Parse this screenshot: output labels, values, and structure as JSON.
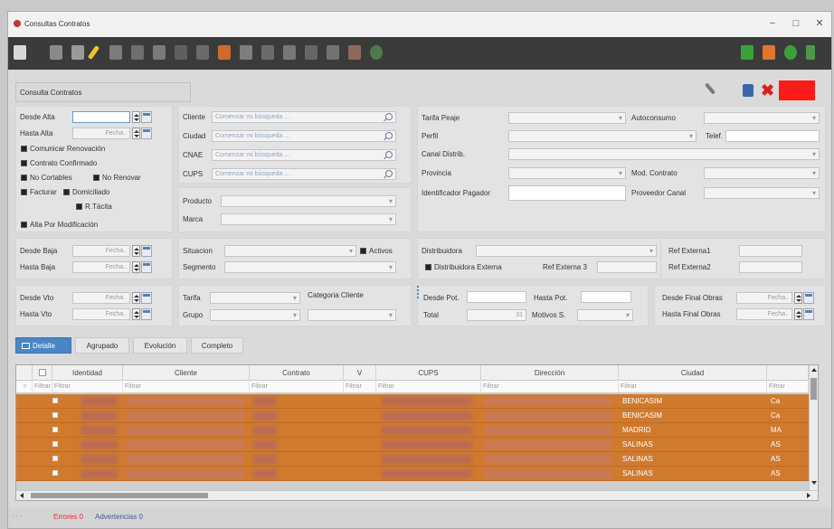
{
  "window": {
    "title": "Consultas Contratos",
    "minimize": "−",
    "maximize": "□",
    "close": "✕"
  },
  "header": {
    "title": "Consulta Contratos",
    "cancel_label": "Cancel"
  },
  "filters": {
    "desde_alta": "Desde Alta",
    "hasta_alta": "Hasta Alta",
    "fecha_placeholder": "Fecha..",
    "comunicar_renovacion": "Comunicar Renovación",
    "contrato_confirmado": "Contrato Confirmado",
    "no_cortables": "No Cortables",
    "no_renovar": "No Renovar",
    "facturar": "Facturar",
    "domiciliado": "Domiciliado",
    "r_tacita": "R.Tácita",
    "alta_por_modificacion": "Alta Por Modificación",
    "cliente": "Cliente",
    "ciudad": "Ciudad",
    "cnae": "CNAE",
    "cups": "CUPS",
    "search_placeholder": "Comenzar mi búsqueda ...",
    "producto": "Producto",
    "marca": "Marca",
    "tarifa_peaje": "Tarifa Peaje",
    "autoconsumo": "Autoconsumo",
    "perfil": "Perfil",
    "telef": "Telef.",
    "canal_distrib": "Canal Distrib.",
    "provincia": "Provincia",
    "mod_contrato": "Mod. Contrato",
    "identificador_pagador": "Identificador Pagador",
    "proveedor_canal": "Proveedor Canal",
    "desde_baja": "Desde Baja",
    "hasta_baja": "Hasta Baja",
    "situacion": "Situacion",
    "activos": "Activos",
    "segmento": "Segmento",
    "distribuidora": "Distribuidora",
    "distribuidora_externa": "Distribuidora Externa",
    "ref_externa1": "Ref Externa1",
    "ref_externa2": "Ref Externa2",
    "ref_externa3": "Ref Externa 3",
    "desde_vto": "Desde Vto",
    "hasta_vto": "Hasta Vto",
    "tarifa": "Tarifa",
    "categoria_cliente": "Categoria Cliente",
    "grupo": "Grupo",
    "desde_pot": "Desde Pot.",
    "hasta_pot": "Hasta Pot.",
    "total": "Total",
    "total_value": "31",
    "motivos_s": "Motivos S.",
    "desde_final_obras": "Desde Final Obras",
    "hasta_final_obras": "Hasta Final Obras"
  },
  "tabs": [
    {
      "label": "Detalle"
    },
    {
      "label": "Agrupado"
    },
    {
      "label": "Evolución"
    },
    {
      "label": "Completo"
    }
  ],
  "grid": {
    "columns": [
      "Identidad",
      "Cliente",
      "Contrato",
      "V",
      "CUPS",
      "Dirección",
      "Ciudad"
    ],
    "filter_placeholder": "Filtrar",
    "rows": [
      {
        "ciudad": "BENICASIM",
        "extra": "Ca"
      },
      {
        "ciudad": "BENICASIM",
        "extra": "Ca"
      },
      {
        "ciudad": "MADRID",
        "extra": "MA"
      },
      {
        "ciudad": "SALINAS",
        "extra": "AS"
      },
      {
        "ciudad": "SALINAS",
        "extra": "AS"
      },
      {
        "ciudad": "SALINAS",
        "extra": "AS"
      }
    ]
  },
  "status": {
    "errores": "Errores 0",
    "advertencias": "Advertencias 0"
  },
  "colors": {
    "accent": "#4a86c5",
    "row": "#d07a2e",
    "cancel": "#ff1a1a",
    "toolbar": "#3b3b3b"
  }
}
